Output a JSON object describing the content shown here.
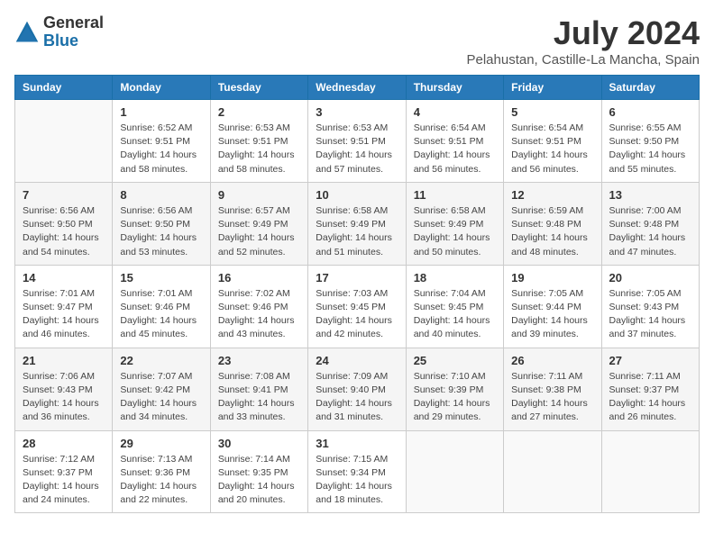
{
  "logo": {
    "general": "General",
    "blue": "Blue"
  },
  "title": {
    "month": "July 2024",
    "location": "Pelahustan, Castille-La Mancha, Spain"
  },
  "weekdays": [
    "Sunday",
    "Monday",
    "Tuesday",
    "Wednesday",
    "Thursday",
    "Friday",
    "Saturday"
  ],
  "weeks": [
    [
      {
        "day": "",
        "info": ""
      },
      {
        "day": "1",
        "info": "Sunrise: 6:52 AM\nSunset: 9:51 PM\nDaylight: 14 hours\nand 58 minutes."
      },
      {
        "day": "2",
        "info": "Sunrise: 6:53 AM\nSunset: 9:51 PM\nDaylight: 14 hours\nand 58 minutes."
      },
      {
        "day": "3",
        "info": "Sunrise: 6:53 AM\nSunset: 9:51 PM\nDaylight: 14 hours\nand 57 minutes."
      },
      {
        "day": "4",
        "info": "Sunrise: 6:54 AM\nSunset: 9:51 PM\nDaylight: 14 hours\nand 56 minutes."
      },
      {
        "day": "5",
        "info": "Sunrise: 6:54 AM\nSunset: 9:51 PM\nDaylight: 14 hours\nand 56 minutes."
      },
      {
        "day": "6",
        "info": "Sunrise: 6:55 AM\nSunset: 9:50 PM\nDaylight: 14 hours\nand 55 minutes."
      }
    ],
    [
      {
        "day": "7",
        "info": "Sunrise: 6:56 AM\nSunset: 9:50 PM\nDaylight: 14 hours\nand 54 minutes."
      },
      {
        "day": "8",
        "info": "Sunrise: 6:56 AM\nSunset: 9:50 PM\nDaylight: 14 hours\nand 53 minutes."
      },
      {
        "day": "9",
        "info": "Sunrise: 6:57 AM\nSunset: 9:49 PM\nDaylight: 14 hours\nand 52 minutes."
      },
      {
        "day": "10",
        "info": "Sunrise: 6:58 AM\nSunset: 9:49 PM\nDaylight: 14 hours\nand 51 minutes."
      },
      {
        "day": "11",
        "info": "Sunrise: 6:58 AM\nSunset: 9:49 PM\nDaylight: 14 hours\nand 50 minutes."
      },
      {
        "day": "12",
        "info": "Sunrise: 6:59 AM\nSunset: 9:48 PM\nDaylight: 14 hours\nand 48 minutes."
      },
      {
        "day": "13",
        "info": "Sunrise: 7:00 AM\nSunset: 9:48 PM\nDaylight: 14 hours\nand 47 minutes."
      }
    ],
    [
      {
        "day": "14",
        "info": "Sunrise: 7:01 AM\nSunset: 9:47 PM\nDaylight: 14 hours\nand 46 minutes."
      },
      {
        "day": "15",
        "info": "Sunrise: 7:01 AM\nSunset: 9:46 PM\nDaylight: 14 hours\nand 45 minutes."
      },
      {
        "day": "16",
        "info": "Sunrise: 7:02 AM\nSunset: 9:46 PM\nDaylight: 14 hours\nand 43 minutes."
      },
      {
        "day": "17",
        "info": "Sunrise: 7:03 AM\nSunset: 9:45 PM\nDaylight: 14 hours\nand 42 minutes."
      },
      {
        "day": "18",
        "info": "Sunrise: 7:04 AM\nSunset: 9:45 PM\nDaylight: 14 hours\nand 40 minutes."
      },
      {
        "day": "19",
        "info": "Sunrise: 7:05 AM\nSunset: 9:44 PM\nDaylight: 14 hours\nand 39 minutes."
      },
      {
        "day": "20",
        "info": "Sunrise: 7:05 AM\nSunset: 9:43 PM\nDaylight: 14 hours\nand 37 minutes."
      }
    ],
    [
      {
        "day": "21",
        "info": "Sunrise: 7:06 AM\nSunset: 9:43 PM\nDaylight: 14 hours\nand 36 minutes."
      },
      {
        "day": "22",
        "info": "Sunrise: 7:07 AM\nSunset: 9:42 PM\nDaylight: 14 hours\nand 34 minutes."
      },
      {
        "day": "23",
        "info": "Sunrise: 7:08 AM\nSunset: 9:41 PM\nDaylight: 14 hours\nand 33 minutes."
      },
      {
        "day": "24",
        "info": "Sunrise: 7:09 AM\nSunset: 9:40 PM\nDaylight: 14 hours\nand 31 minutes."
      },
      {
        "day": "25",
        "info": "Sunrise: 7:10 AM\nSunset: 9:39 PM\nDaylight: 14 hours\nand 29 minutes."
      },
      {
        "day": "26",
        "info": "Sunrise: 7:11 AM\nSunset: 9:38 PM\nDaylight: 14 hours\nand 27 minutes."
      },
      {
        "day": "27",
        "info": "Sunrise: 7:11 AM\nSunset: 9:37 PM\nDaylight: 14 hours\nand 26 minutes."
      }
    ],
    [
      {
        "day": "28",
        "info": "Sunrise: 7:12 AM\nSunset: 9:37 PM\nDaylight: 14 hours\nand 24 minutes."
      },
      {
        "day": "29",
        "info": "Sunrise: 7:13 AM\nSunset: 9:36 PM\nDaylight: 14 hours\nand 22 minutes."
      },
      {
        "day": "30",
        "info": "Sunrise: 7:14 AM\nSunset: 9:35 PM\nDaylight: 14 hours\nand 20 minutes."
      },
      {
        "day": "31",
        "info": "Sunrise: 7:15 AM\nSunset: 9:34 PM\nDaylight: 14 hours\nand 18 minutes."
      },
      {
        "day": "",
        "info": ""
      },
      {
        "day": "",
        "info": ""
      },
      {
        "day": "",
        "info": ""
      }
    ]
  ]
}
